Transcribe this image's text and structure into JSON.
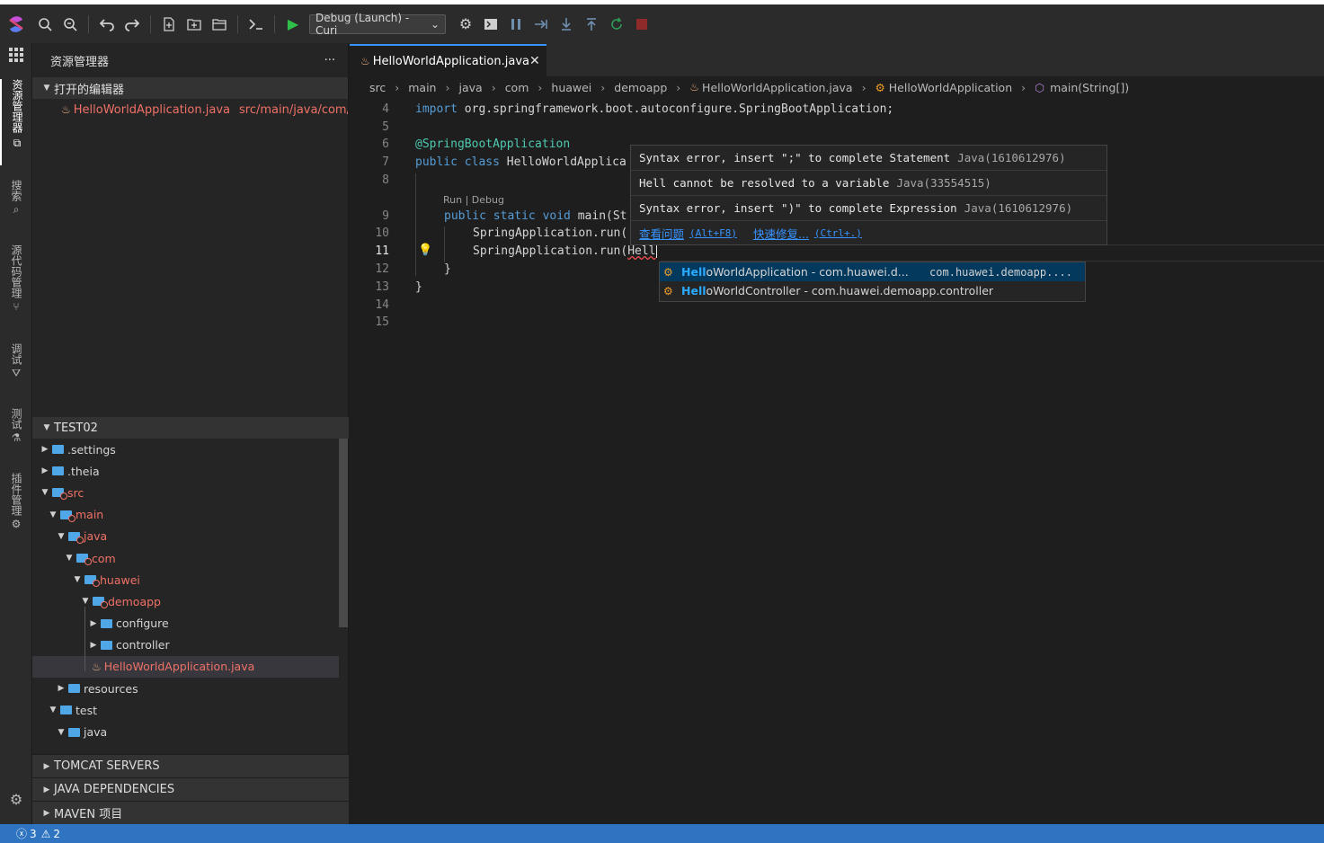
{
  "toolbar": {
    "debug_config": "Debug (Launch) - Curi",
    "icons": [
      "logo-icon",
      "search-icon",
      "search-replace-icon",
      "undo-icon",
      "redo-icon",
      "new-file-icon",
      "new-folder-icon",
      "open-folder-icon",
      "terminal-icon",
      "run-icon",
      "gear-icon",
      "debug-console-icon",
      "pause-icon",
      "step-over-icon",
      "step-into-icon",
      "step-out-icon",
      "restart-icon",
      "stop-icon"
    ]
  },
  "activity": {
    "items": [
      "资源管理器",
      "搜索",
      "源代码管理",
      "调试",
      "测试",
      "插件管理"
    ]
  },
  "sidebar": {
    "title": "资源管理器",
    "more": "···",
    "open_editors_label": "打开的编辑器",
    "open_editor_file": "HelloWorldApplication.java",
    "open_editor_path": "src/main/java/com/...",
    "project_label": "TEST02",
    "tree": [
      {
        "label": ".settings"
      },
      {
        "label": ".theia"
      },
      {
        "label": "src"
      },
      {
        "label": "main"
      },
      {
        "label": "java"
      },
      {
        "label": "com"
      },
      {
        "label": "huawei"
      },
      {
        "label": "demoapp"
      },
      {
        "label": "configure"
      },
      {
        "label": "controller"
      },
      {
        "label": "HelloWorldApplication.java"
      },
      {
        "label": "resources"
      },
      {
        "label": "test"
      },
      {
        "label": "java"
      }
    ],
    "sections": [
      "TOMCAT SERVERS",
      "JAVA DEPENDENCIES",
      "MAVEN 项目"
    ]
  },
  "editor": {
    "tab_label": "HelloWorldApplication.java",
    "breadcrumb": [
      "src",
      "main",
      "java",
      "com",
      "huawei",
      "demoapp",
      "HelloWorldApplication.java",
      "HelloWorldApplication",
      "main(String[])"
    ],
    "line_numbers": [
      "4",
      "5",
      "6",
      "7",
      "8",
      "9",
      "10",
      "11",
      "12",
      "13",
      "14",
      "15"
    ],
    "lines": {
      "l4_kw": "import",
      "l4_rest": " org.springframework.boot.autoconfigure.SpringBootApplication;",
      "l6": "@SpringBootApplication",
      "l7_kw": "public class",
      "l7_rest": " HelloWorldApplica",
      "codelens": "Run | Debug",
      "l9_kw": "public static void",
      "l9_rest": " main(St",
      "l10": "SpringApplication.run(",
      "l11_pre": "SpringApplication.run(",
      "l11_err": "Hell",
      "l12": "}",
      "l13": "}"
    }
  },
  "hover": {
    "problems": [
      {
        "msg": "Syntax error, insert \";\" to complete Statement",
        "src": "Java(1610612976)"
      },
      {
        "msg": "Hell cannot be resolved to a variable",
        "src": "Java(33554515)"
      },
      {
        "msg": "Syntax error, insert \")\" to complete Expression",
        "src": "Java(1610612976)"
      }
    ],
    "view_problem": "查看问题",
    "view_problem_kb": "(Alt+F8)",
    "quick_fix": "快速修复...",
    "quick_fix_kb": "(Ctrl+.)"
  },
  "suggest": {
    "items": [
      {
        "match": "Hell",
        "rest": "oWorldApplication - com.huawei.d...",
        "detail": "com.huawei.demoapp...."
      },
      {
        "match": "Hell",
        "rest": "oWorldController - com.huawei.demoapp.controller",
        "detail": ""
      }
    ]
  },
  "status": {
    "errors": "3",
    "warnings": "2"
  },
  "colors": {
    "accent": "#3794ff",
    "statusbar": "#2f74c0",
    "error": "#f07166"
  }
}
